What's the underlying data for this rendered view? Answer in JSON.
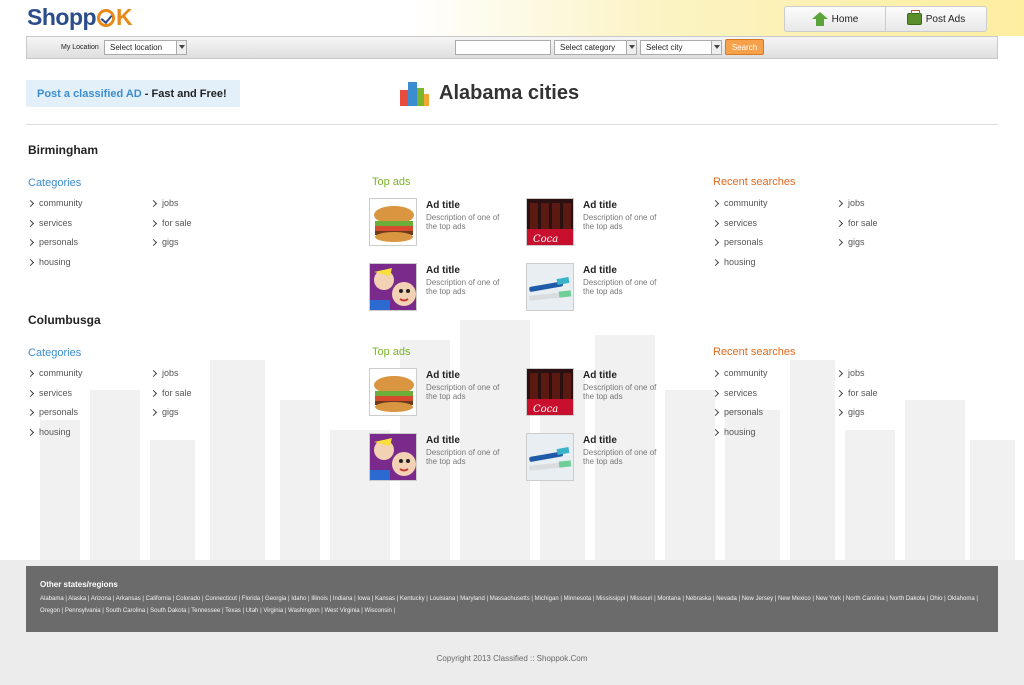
{
  "header": {
    "logo_main": "Shopp",
    "logo_ok": "K",
    "nav": [
      {
        "label": "Home",
        "icon": "home-icon"
      },
      {
        "label": "Post Ads",
        "icon": "briefcase-icon"
      }
    ]
  },
  "searchbar": {
    "location_label": "My Location",
    "location_select": "Select location",
    "keyword_value": "",
    "category_select": "Select category",
    "city_select": "Select city",
    "search_button": "Search"
  },
  "promo": {
    "highlight": "Post a classified AD",
    "rest": " - Fast and Free!"
  },
  "page_title": "Alabama cities",
  "cities": [
    {
      "name": "Birmingham",
      "categories_heading": "Categories",
      "categories_col1": [
        "community",
        "services",
        "personals",
        "housing"
      ],
      "categories_col2": [
        "jobs",
        "for sale",
        "gigs"
      ],
      "top_ads_heading": "Top ads",
      "ads": [
        {
          "title": "Ad title",
          "desc": "Description of one of the top ads",
          "image": "burger"
        },
        {
          "title": "Ad title",
          "desc": "Description of one of the top ads",
          "image": "cola"
        },
        {
          "title": "Ad title",
          "desc": "Description of one of the top ads",
          "image": "popart"
        },
        {
          "title": "Ad title",
          "desc": "Description of one of the top ads",
          "image": "toothbrush"
        }
      ],
      "recent_heading": "Recent searches",
      "recent_col1": [
        "community",
        "services",
        "personals",
        "housing"
      ],
      "recent_col2": [
        "jobs",
        "for sale",
        "gigs"
      ]
    },
    {
      "name": "Columbusga",
      "categories_heading": "Categories",
      "categories_col1": [
        "community",
        "services",
        "personals",
        "housing"
      ],
      "categories_col2": [
        "jobs",
        "for sale",
        "gigs"
      ],
      "top_ads_heading": "Top ads",
      "ads": [
        {
          "title": "Ad title",
          "desc": "Description of one of the top ads",
          "image": "burger"
        },
        {
          "title": "Ad title",
          "desc": "Description of one of the top ads",
          "image": "cola"
        },
        {
          "title": "Ad title",
          "desc": "Description of one of the top ads",
          "image": "popart"
        },
        {
          "title": "Ad title",
          "desc": "Description of one of the top ads",
          "image": "toothbrush"
        }
      ],
      "recent_heading": "Recent searches",
      "recent_col1": [
        "community",
        "services",
        "personals",
        "housing"
      ],
      "recent_col2": [
        "jobs",
        "for sale",
        "gigs"
      ]
    }
  ],
  "footer": {
    "heading": "Other states/regions",
    "states": [
      "Alabama",
      "Alaska",
      "Arizona",
      "Arkansas",
      "California",
      "Colorado",
      "Connecticut",
      "Florida",
      "Georgia",
      "Idaho",
      "Illinois",
      "Indiana",
      "Iowa",
      "Kansas",
      "Kentucky",
      "Louisiana",
      "Maryland",
      "Massachusetts",
      "Michigan",
      "Minnesota",
      "Mississippi",
      "Missouri",
      "Montana",
      "Nebraska",
      "Nevada",
      "New Jersey",
      "New Mexico",
      "New York",
      "North Carolina",
      "North Dakota",
      "Ohio",
      "Oklahoma",
      "Oregon",
      "Pennsylvania",
      "South Carolina",
      "South Dakota",
      "Tennessee",
      "Texas",
      "Utah",
      "Virginia",
      "Washington",
      "West Virginia",
      "Wisconsin"
    ],
    "copyright": "Copyright 2013 Classified :: Shoppok.Com"
  },
  "colors": {
    "accent_blue": "#3b8dd0",
    "accent_green": "#7ab42a",
    "accent_orange": "#e0691d",
    "search_button": "#f6a04a"
  }
}
